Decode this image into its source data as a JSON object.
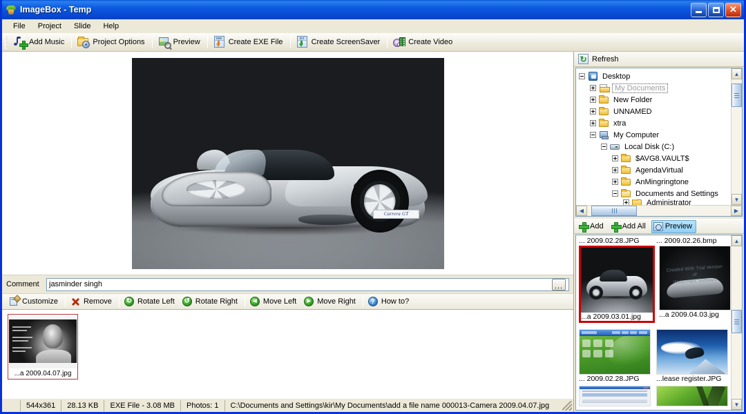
{
  "window": {
    "app_title": "ImageBox",
    "title_separator": "-",
    "project_name": "Temp",
    "icon": "plant-icon",
    "minimize": "Minimize",
    "maximize": "Maximize",
    "close": "Close"
  },
  "menubar": {
    "items": [
      {
        "label": "File"
      },
      {
        "label": "Project"
      },
      {
        "label": "Slide"
      },
      {
        "label": "Help"
      }
    ]
  },
  "toolbar": {
    "items": [
      {
        "label": "Add Music",
        "icon": "music-note-add-icon"
      },
      {
        "label": "Project Options",
        "icon": "folder-gear-icon"
      },
      {
        "label": "Preview",
        "icon": "picture-magnifier-icon"
      },
      {
        "label": "Create EXE File",
        "icon": "exe-download-icon"
      },
      {
        "label": "Create ScreenSaver",
        "icon": "scr-download-icon"
      },
      {
        "label": "Create Video",
        "icon": "disc-film-icon"
      }
    ]
  },
  "preview": {
    "image_caption": "Porsche Carrera GT silver convertible",
    "plate_text": "Carrera GT"
  },
  "comment": {
    "label": "Comment",
    "value": "jasminder singh",
    "placeholder": "",
    "browse_label": "..."
  },
  "actions": {
    "items": [
      {
        "label": "Customize",
        "icon": "customize-icon"
      },
      {
        "label": "Remove",
        "icon": "remove-x-icon"
      },
      {
        "label": "Rotate Left",
        "icon": "rotate-left-icon",
        "glyph": "↻"
      },
      {
        "label": "Rotate Right",
        "icon": "rotate-right-icon",
        "glyph": "↺"
      },
      {
        "label": "Move Left",
        "icon": "move-left-icon",
        "glyph": "◀"
      },
      {
        "label": "Move Right",
        "icon": "move-right-icon",
        "glyph": "▶"
      },
      {
        "label": "How to?",
        "icon": "help-question-icon",
        "glyph": "?"
      }
    ]
  },
  "filmstrip": {
    "slides": [
      {
        "caption": "...a  2009.04.07.jpg",
        "selected": true,
        "thumb": "grayscale-man-photo"
      }
    ]
  },
  "statusbar": {
    "dimensions": "544x361",
    "file_size": "28.13 KB",
    "exe_info": "EXE File - 3.08 MB",
    "photos": "Photos: 1",
    "path": "C:\\Documents and Settings\\kir\\My Documents\\add a file name  000013-Camera  2009.04.07.jpg"
  },
  "right_panel": {
    "refresh": {
      "label": "Refresh",
      "icon": "refresh-icon"
    },
    "tree": [
      {
        "label": "Desktop",
        "depth": 0,
        "toggle": "minus",
        "icon": "desktop-icon",
        "focused": false
      },
      {
        "label": "My Documents",
        "depth": 1,
        "toggle": "plus",
        "icon": "my-documents-icon",
        "focused": true
      },
      {
        "label": "New Folder",
        "depth": 1,
        "toggle": "plus",
        "icon": "folder-icon",
        "focused": false
      },
      {
        "label": "UNNAMED",
        "depth": 1,
        "toggle": "plus",
        "icon": "folder-icon",
        "focused": false
      },
      {
        "label": "xtra",
        "depth": 1,
        "toggle": "plus",
        "icon": "folder-icon",
        "focused": false
      },
      {
        "label": "My Computer",
        "depth": 1,
        "toggle": "minus",
        "icon": "computer-icon",
        "focused": false
      },
      {
        "label": "Local Disk (C:)",
        "depth": 2,
        "toggle": "minus",
        "icon": "disk-icon",
        "focused": false
      },
      {
        "label": "$AVG8.VAULT$",
        "depth": 3,
        "toggle": "plus",
        "icon": "folder-icon",
        "focused": false
      },
      {
        "label": "AgendaVirtual",
        "depth": 3,
        "toggle": "plus",
        "icon": "folder-icon",
        "focused": false
      },
      {
        "label": "AnMingringtone",
        "depth": 3,
        "toggle": "plus",
        "icon": "folder-icon",
        "focused": false
      },
      {
        "label": "Documents and Settings",
        "depth": 3,
        "toggle": "minus",
        "icon": "folder-open-icon",
        "focused": false
      },
      {
        "label": "Administrator",
        "depth": 4,
        "toggle": "plus",
        "icon": "folder-icon",
        "focused": false
      }
    ],
    "add_bar": [
      {
        "label": "Add",
        "icon": "plus-icon",
        "pressed": false
      },
      {
        "label": "Add All",
        "icon": "plus-icon",
        "pressed": false
      },
      {
        "label": "Preview",
        "icon": "magnifier-icon",
        "pressed": true
      }
    ],
    "thumbnails": [
      {
        "caption": "...  2009.02.28.JPG",
        "selected": false,
        "thumb": "porsche-silver"
      },
      {
        "caption": "...  2009.02.26.bmp",
        "selected": false,
        "thumb": "dark-car-watermark"
      },
      {
        "caption": "...a  2009.03.01.jpg",
        "selected": true,
        "thumb": "porsche-silver"
      },
      {
        "caption": "...a  2009.04.03.jpg",
        "selected": false,
        "thumb": "dark-car-watermark"
      },
      {
        "caption": "...  2009.02.28.JPG",
        "selected": false,
        "thumb": "green-desktop"
      },
      {
        "caption": "...lease register.JPG",
        "selected": false,
        "thumb": "snowboarder-sky"
      },
      {
        "caption": "",
        "selected": false,
        "thumb": "dialog-window"
      },
      {
        "caption": "",
        "selected": false,
        "thumb": "green-abstract"
      }
    ],
    "scroll": {
      "up": "▲",
      "down": "▼",
      "left": "◀",
      "right": "▶"
    }
  }
}
